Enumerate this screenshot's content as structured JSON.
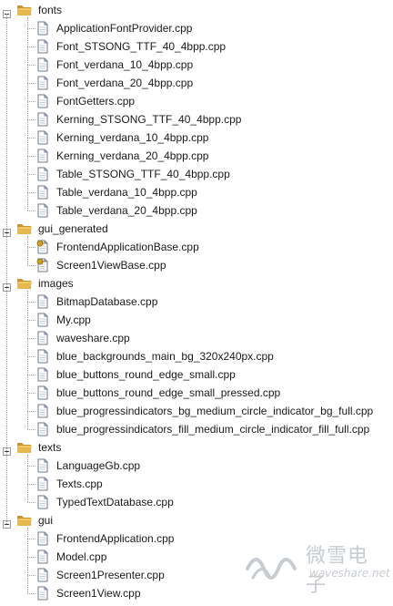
{
  "tree": {
    "folders": [
      {
        "name": "fonts",
        "files": [
          "ApplicationFontProvider.cpp",
          "Font_STSONG_TTF_40_4bpp.cpp",
          "Font_verdana_10_4bpp.cpp",
          "Font_verdana_20_4bpp.cpp",
          "FontGetters.cpp",
          "Kerning_STSONG_TTF_40_4bpp.cpp",
          "Kerning_verdana_10_4bpp.cpp",
          "Kerning_verdana_20_4bpp.cpp",
          "Table_STSONG_TTF_40_4bpp.cpp",
          "Table_verdana_10_4bpp.cpp",
          "Table_verdana_20_4bpp.cpp"
        ]
      },
      {
        "name": "gui_generated",
        "files": [
          "FrontendApplicationBase.cpp",
          "Screen1ViewBase.cpp"
        ],
        "file_icon": "generated-source-file-icon"
      },
      {
        "name": "images",
        "files": [
          "BitmapDatabase.cpp",
          "My.cpp",
          "waveshare.cpp",
          "blue_backgrounds_main_bg_320x240px.cpp",
          "blue_buttons_round_edge_small.cpp",
          "blue_buttons_round_edge_small_pressed.cpp",
          "blue_progressindicators_bg_medium_circle_indicator_bg_full.cpp",
          "blue_progressindicators_fill_medium_circle_indicator_fill_full.cpp"
        ]
      },
      {
        "name": "texts",
        "files": [
          "LanguageGb.cpp",
          "Texts.cpp",
          "TypedTextDatabase.cpp"
        ]
      },
      {
        "name": "gui",
        "files": [
          "FrontendApplication.cpp",
          "Model.cpp",
          "Screen1Presenter.cpp",
          "Screen1View.cpp"
        ]
      }
    ]
  },
  "watermark": {
    "cn": "微雪电子",
    "en": "waveshare.net"
  },
  "colors": {
    "folder": "#e8b84a",
    "folder_dark": "#c9952a",
    "file_border": "#6b7a8c",
    "file_fill": "#ffffff",
    "generated_badge": "#d4a017",
    "guide": "#a0a0a0",
    "watermark": "#9aa3ad"
  }
}
